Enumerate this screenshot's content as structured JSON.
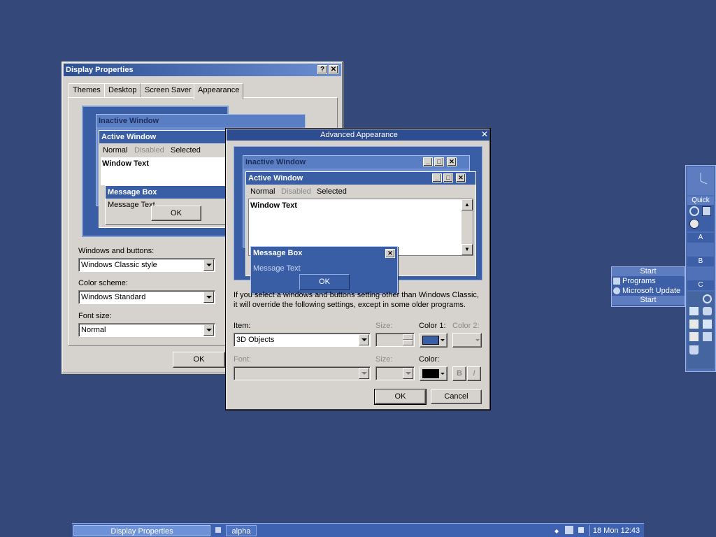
{
  "display_properties": {
    "title": "Display Properties",
    "title_buttons": [
      "?",
      "✕"
    ],
    "tabs": [
      {
        "label": "Themes"
      },
      {
        "label": "Desktop"
      },
      {
        "label": "Screen Saver"
      },
      {
        "label": "Appearance",
        "selected": true
      }
    ],
    "preview": {
      "inactive_title": "Inactive Window",
      "active_title": "Active Window",
      "menu": [
        "Normal",
        "Disabled",
        "Selected"
      ],
      "window_text": "Window Text",
      "message_box_title": "Message Box",
      "message_text": "Message Text",
      "ok_label": "OK"
    },
    "windows_buttons_label": "Windows and buttons:",
    "windows_buttons_value": "Windows Classic style",
    "color_scheme_label": "Color scheme:",
    "color_scheme_value": "Windows Standard",
    "font_size_label": "Font size:",
    "font_size_value": "Normal",
    "ok_label": "OK"
  },
  "advanced": {
    "title": "Advanced Appearance",
    "close_glyph": "✕",
    "preview": {
      "inactive_title": "Inactive Window",
      "active_title": "Active Window",
      "menu": [
        "Normal",
        "Disabled",
        "Selected"
      ],
      "window_text": "Window Text",
      "message_box_title": "Message Box",
      "message_text": "Message Text",
      "ok_label": "OK"
    },
    "info_line1": "If you select a windows and buttons setting other than Windows Classic,",
    "info_line2": "it will override the following settings, except in some older programs.",
    "item_label": "Item:",
    "item_value": "3D Objects",
    "size_label": "Size:",
    "color1_label": "Color 1:",
    "color2_label": "Color 2:",
    "font_label": "Font:",
    "font_size_label": "Size:",
    "color_label": "Color:",
    "bold_label": "B",
    "italic_label": "I",
    "ok_label": "OK",
    "cancel_label": "Cancel",
    "color1_swatch": "#3a5ea5",
    "color_swatch": "#000000"
  },
  "side_panel": {
    "quick_label": "Quick",
    "sections": [
      "A",
      "B",
      "C"
    ]
  },
  "start_menu": {
    "header": "Start",
    "items": [
      "Programs",
      "Microsoft Update"
    ],
    "footer": "Start"
  },
  "taskbar": {
    "tasks": [
      "Display Properties",
      "alpha"
    ],
    "clock": "18 Mon 12:43"
  }
}
